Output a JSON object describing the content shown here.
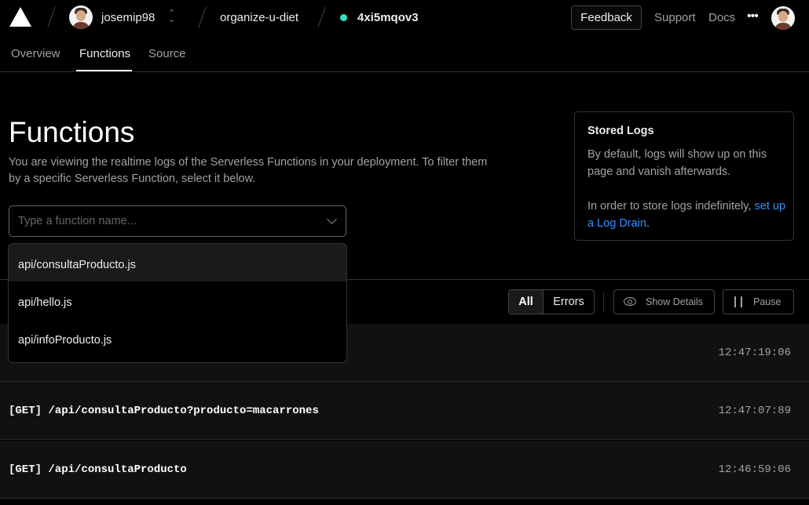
{
  "header": {
    "user": "josemip98",
    "project": "organize-u-diet",
    "deployment": "4xi5mqov3",
    "status_color": "#2ee6c4",
    "feedback_label": "Feedback",
    "support_label": "Support",
    "docs_label": "Docs",
    "more_label": "•••"
  },
  "tabs": [
    {
      "label": "Overview"
    },
    {
      "label": "Functions",
      "active": true
    },
    {
      "label": "Source"
    }
  ],
  "main": {
    "title": "Functions",
    "description": "You are viewing the realtime logs of the Serverless Functions in your deployment. To filter them by a specific Serverless Function, select it below.",
    "function_input": {
      "placeholder": "Type a function name...",
      "value": ""
    },
    "dropdown": [
      {
        "label": "api/consultaProducto.js"
      },
      {
        "label": "api/hello.js"
      },
      {
        "label": "api/infoProducto.js"
      }
    ]
  },
  "stored_logs": {
    "title": "Stored Logs",
    "para1": "By default, logs will show up on this page and vanish afterwards.",
    "para2_prefix": "In order to store logs indefinitely,",
    "para2_link": "set up a Log Drain",
    "para2_suffix": "."
  },
  "toolbar": {
    "all_label": "All",
    "errors_label": "Errors",
    "show_details_label": "Show Details",
    "pause_label": "Pause"
  },
  "logs": [
    {
      "text": "",
      "time": "12:47:19:06"
    },
    {
      "text": "[GET] /api/consultaProducto?producto=macarrones",
      "time": "12:47:07:89"
    },
    {
      "text": "[GET] /api/consultaProducto",
      "time": "12:46:59:06"
    }
  ]
}
